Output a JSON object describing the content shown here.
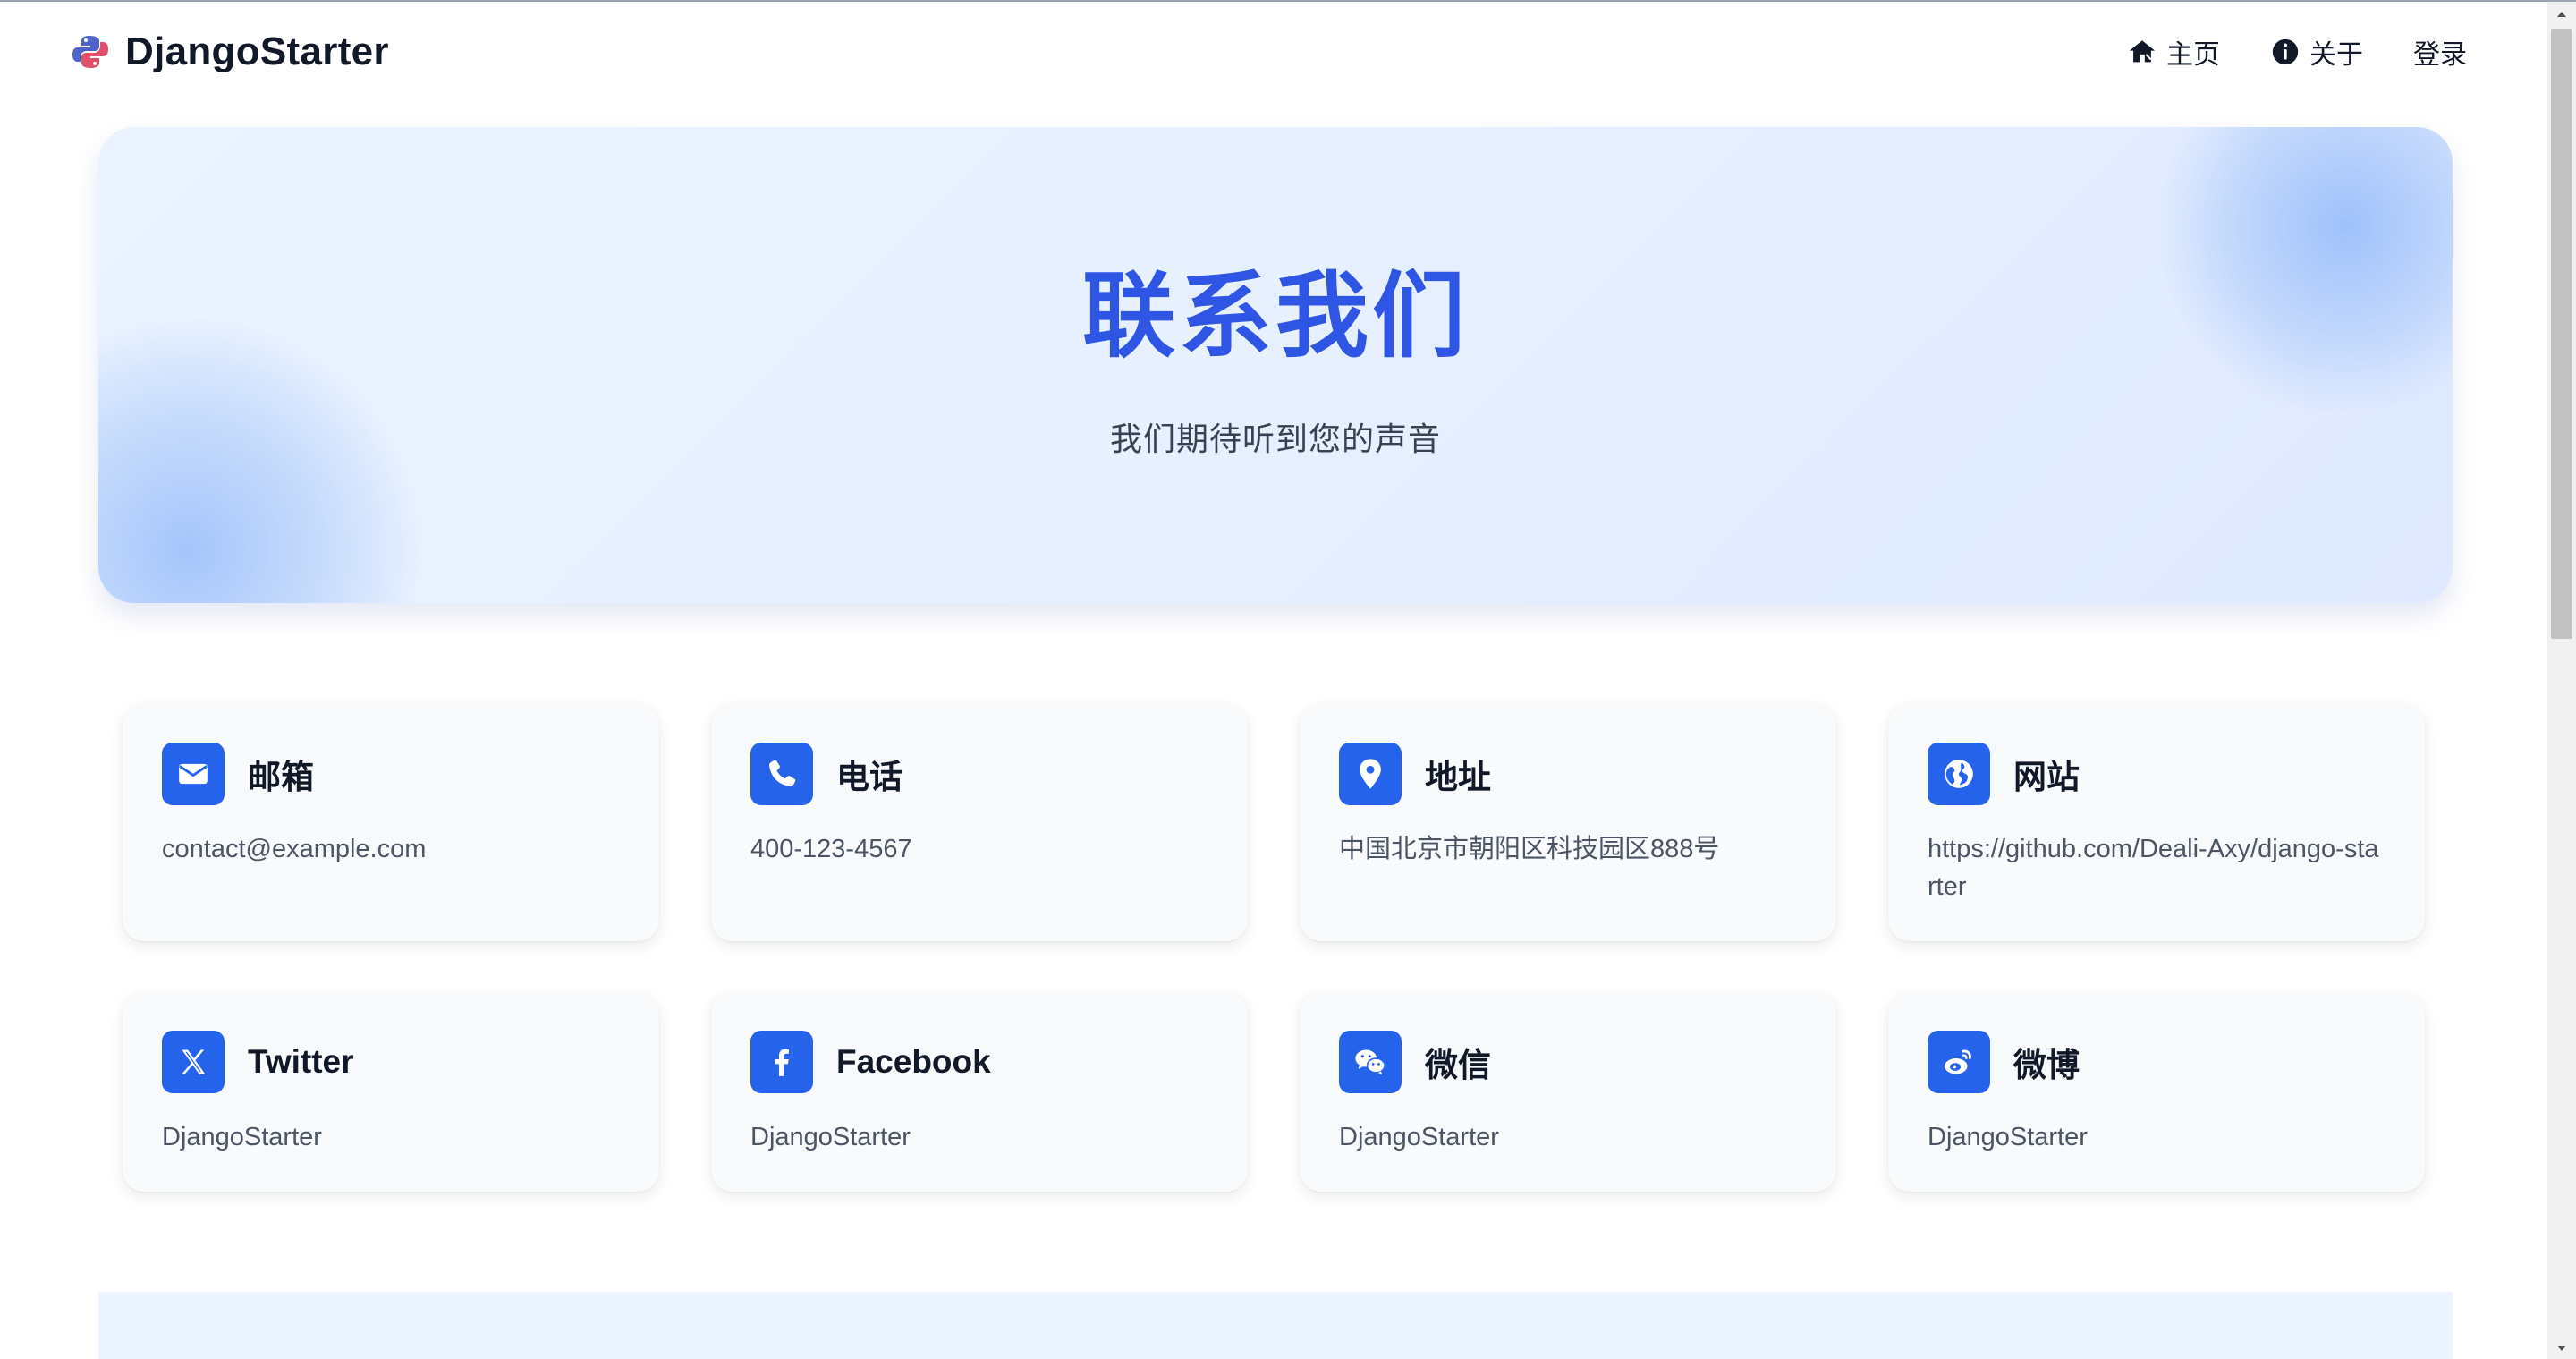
{
  "navbar": {
    "brand": "DjangoStarter",
    "links": [
      {
        "label": "主页",
        "icon": "home-icon"
      },
      {
        "label": "关于",
        "icon": "info-icon"
      },
      {
        "label": "登录"
      }
    ]
  },
  "hero": {
    "title": "联系我们",
    "subtitle": "我们期待听到您的声音"
  },
  "contacts": [
    {
      "title": "邮箱",
      "value": "contact@example.com",
      "icon": "envelope-icon"
    },
    {
      "title": "电话",
      "value": "400-123-4567",
      "icon": "phone-icon"
    },
    {
      "title": "地址",
      "value": "中国北京市朝阳区科技园区888号",
      "icon": "map-pin-icon"
    },
    {
      "title": "网站",
      "value": "https://github.com/Deali-Axy/django-starter",
      "icon": "globe-icon"
    },
    {
      "title": "Twitter",
      "value": "DjangoStarter",
      "icon": "x-twitter-icon"
    },
    {
      "title": "Facebook",
      "value": "DjangoStarter",
      "icon": "facebook-icon"
    },
    {
      "title": "微信",
      "value": "DjangoStarter",
      "icon": "wechat-icon"
    },
    {
      "title": "微博",
      "value": "DjangoStarter",
      "icon": "weibo-icon"
    }
  ],
  "colors": {
    "accent": "#2563eb",
    "hero_title": "#2f55e4",
    "hero_bg": "#e6efff",
    "card_bg": "#f8fafc"
  }
}
